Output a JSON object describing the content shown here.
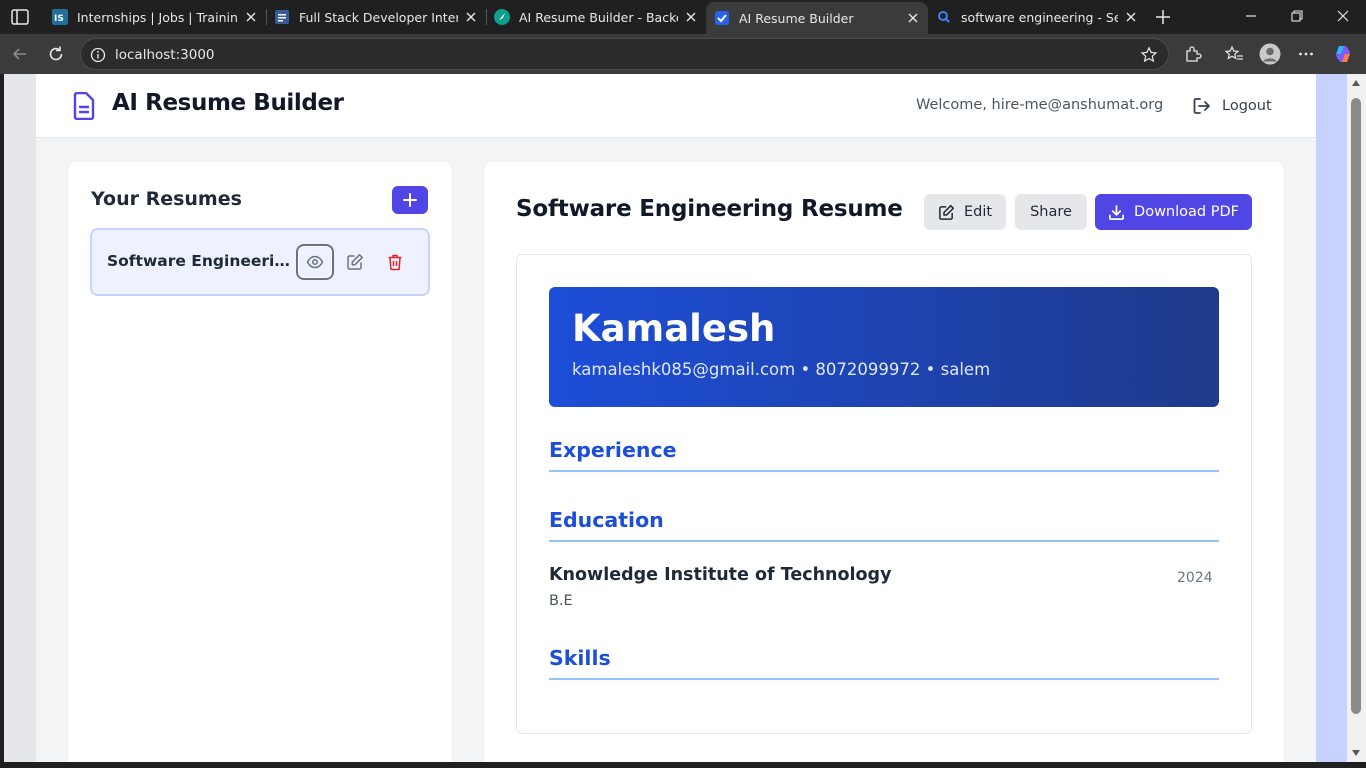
{
  "browser": {
    "tabs": [
      {
        "title": "Internships | Jobs | Trainings &",
        "favicon": "internshala-icon",
        "active": false
      },
      {
        "title": "Full Stack Developer Internship",
        "favicon": "document-icon",
        "active": false
      },
      {
        "title": "AI Resume Builder - Backend -",
        "favicon": "cursor-icon",
        "active": false
      },
      {
        "title": "AI Resume Builder",
        "favicon": "checkbox-icon",
        "active": true
      },
      {
        "title": "software engineering - Search",
        "favicon": "search-icon",
        "active": false
      }
    ],
    "url": "localhost:3000",
    "colors": {
      "frame": "#202020",
      "toolbar": "#3b3b3b"
    }
  },
  "app": {
    "title": "AI Resume Builder",
    "welcome": "Welcome, hire-me@anshumat.org",
    "logout_label": "Logout",
    "colors": {
      "primary": "#4f46e5",
      "heading_blue": "#1d4ed8",
      "danger": "#dc2626"
    }
  },
  "sidebar": {
    "heading": "Your Resumes",
    "add_icon": "plus-icon",
    "resumes": [
      {
        "name": "Software Engineering Resume"
      }
    ]
  },
  "preview": {
    "title": "Software Engineering Resume",
    "edit_label": "Edit",
    "share_label": "Share",
    "download_label": "Download PDF",
    "resume": {
      "name": "Kamalesh",
      "contact": "kamaleshk085@gmail.com • 8072099972 • salem",
      "experience_heading": "Experience",
      "education_heading": "Education",
      "education": [
        {
          "school": "Knowledge Institute of Technology",
          "year": "2024",
          "degree": "B.E"
        }
      ],
      "skills_heading": "Skills"
    }
  }
}
